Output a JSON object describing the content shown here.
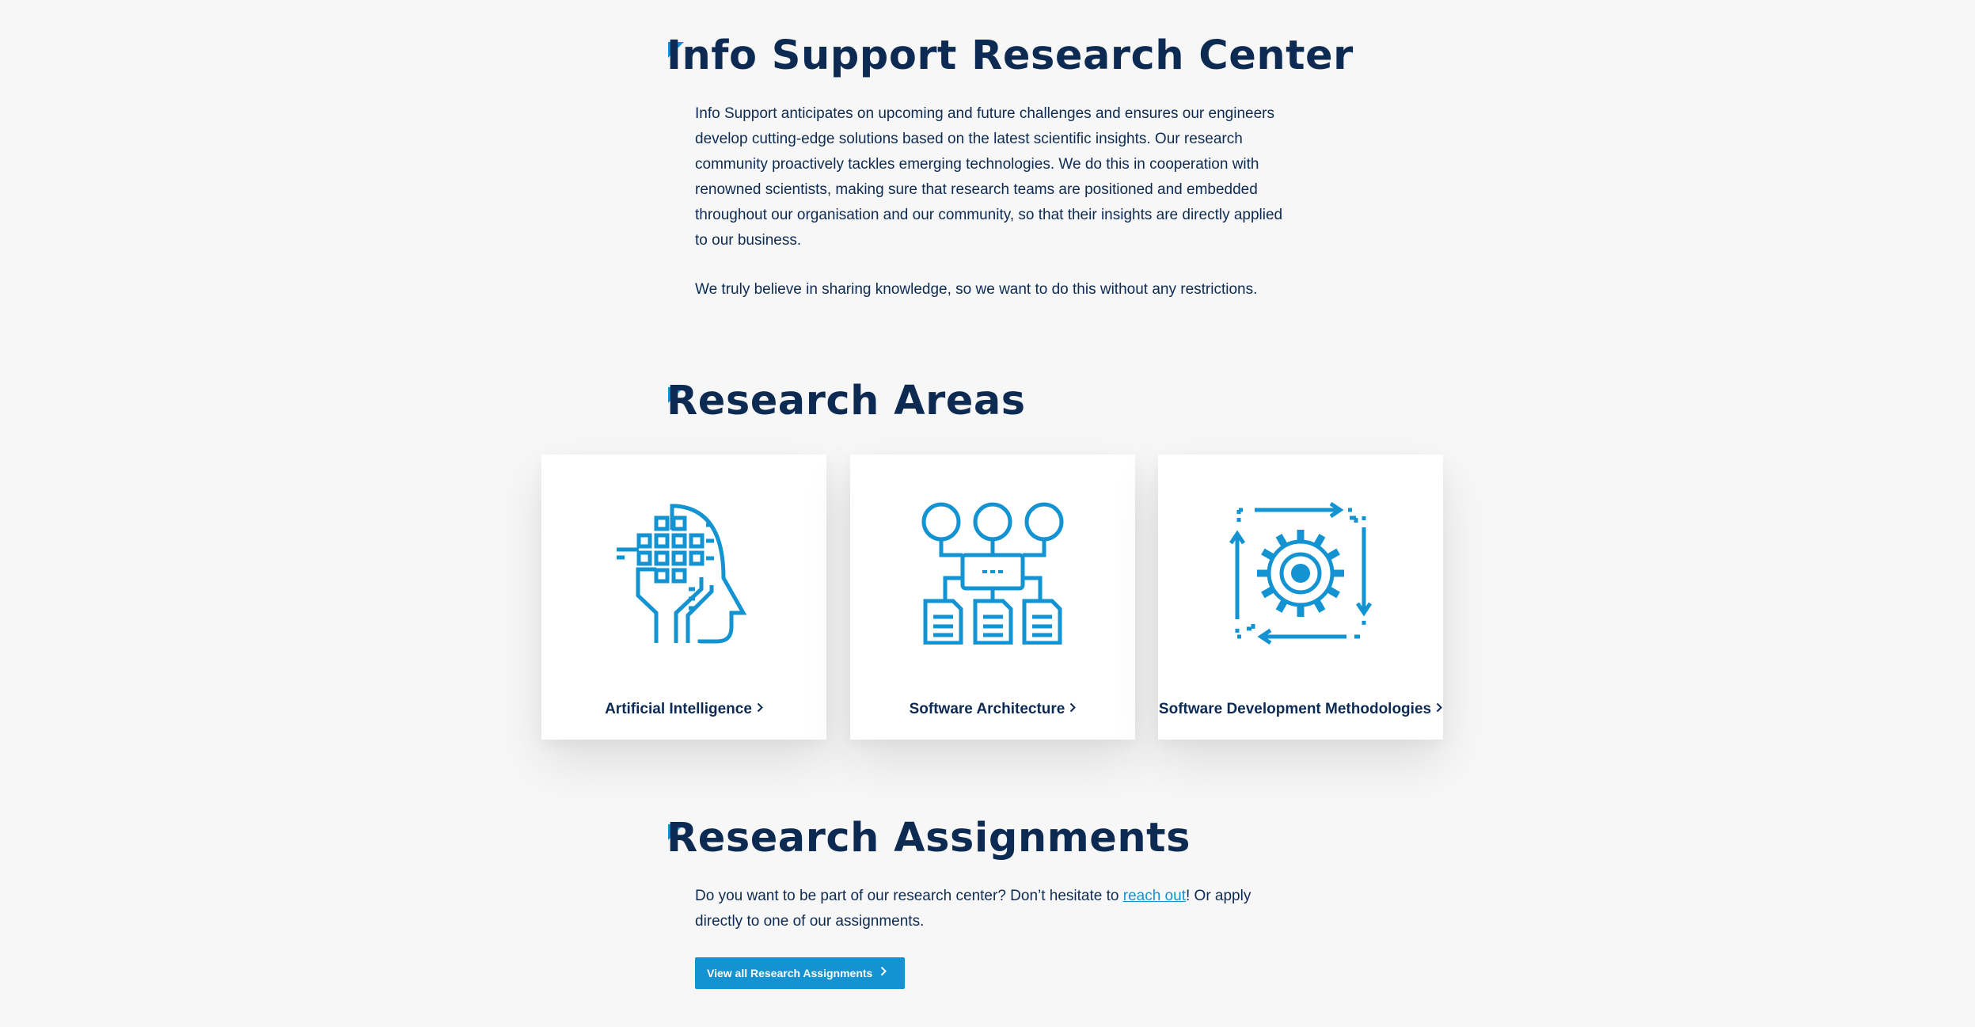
{
  "colors": {
    "background": "#f7f7f7",
    "heading": "#0d2b52",
    "accent": "#1393d2",
    "card": "#ffffff"
  },
  "intro": {
    "title": "Info Support Research Center",
    "paragraph1": "Info Support anticipates on upcoming and future challenges and ensures our engineers develop cutting-edge solutions based on the latest scientific insights. Our research community proactively tackles emerging technologies. We do this in cooperation with renowned scientists, making sure that research teams are positioned and embedded throughout our organisation and our community, so that their insights are directly applied to our business.",
    "paragraph2": "We truly believe in sharing knowledge, so we want to do this without any restrictions."
  },
  "research_areas": {
    "title": "Research Areas",
    "cards": [
      {
        "label": "Artificial Intelligence",
        "icon": "ai-head-icon"
      },
      {
        "label": "Software Architecture",
        "icon": "architecture-diagram-icon"
      },
      {
        "label": "Software Development Methodologies",
        "icon": "gear-cycle-icon"
      }
    ]
  },
  "assignments": {
    "title": "Research Assignments",
    "text_before": "Do you want to be part of our research center? Don’t hesitate to ",
    "link_text": "reach out",
    "text_after": "! Or apply directly to one of our assignments.",
    "button_label": "View all Research Assignments"
  }
}
